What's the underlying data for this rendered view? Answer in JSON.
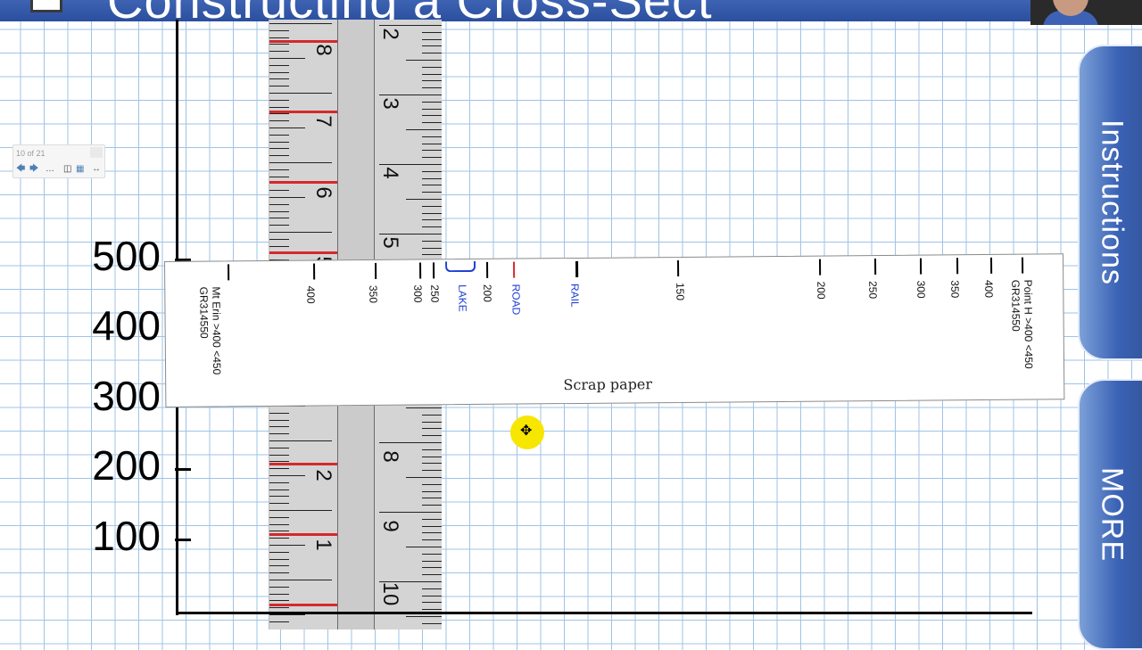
{
  "header": {
    "title_fragment": "Constructing a Cross-Sect"
  },
  "toolbar": {
    "slide_counter": "10 of 21",
    "buttons": [
      "back-arrow-icon",
      "forward-arrow-icon",
      "more-icon",
      "insert-icon",
      "monitor-icon",
      "expand-icon"
    ]
  },
  "graph": {
    "y_labels": [
      "500",
      "400",
      "300",
      "200",
      "100"
    ]
  },
  "ruler": {
    "numbers": [
      "8",
      "7",
      "6",
      "5",
      "2",
      "3",
      "4",
      "5",
      "8",
      "9",
      "10",
      "2",
      "1"
    ],
    "colors": {
      "marks": "#d6282c"
    }
  },
  "scrap_paper": {
    "caption": "Scrap paper",
    "left_label_line1": "Mt Erin >400 <450",
    "left_label_line2": "GR314550",
    "right_label_line1": "Point H >400 <450",
    "right_label_line2": "GR314550",
    "markers": [
      "400",
      "350",
      "300",
      "250",
      "LAKE",
      "200",
      "ROAD",
      "RAIL",
      "150",
      "200",
      "250",
      "300",
      "350",
      "400"
    ],
    "feature_colors": {
      "LAKE": "#1e3fd0",
      "ROAD": "#d6282c",
      "RAIL": "#1e3fd0"
    }
  },
  "side_tabs": {
    "instructions": "Instructions",
    "more": "MORE"
  },
  "pointer_icon": "move-crosshair-icon"
}
